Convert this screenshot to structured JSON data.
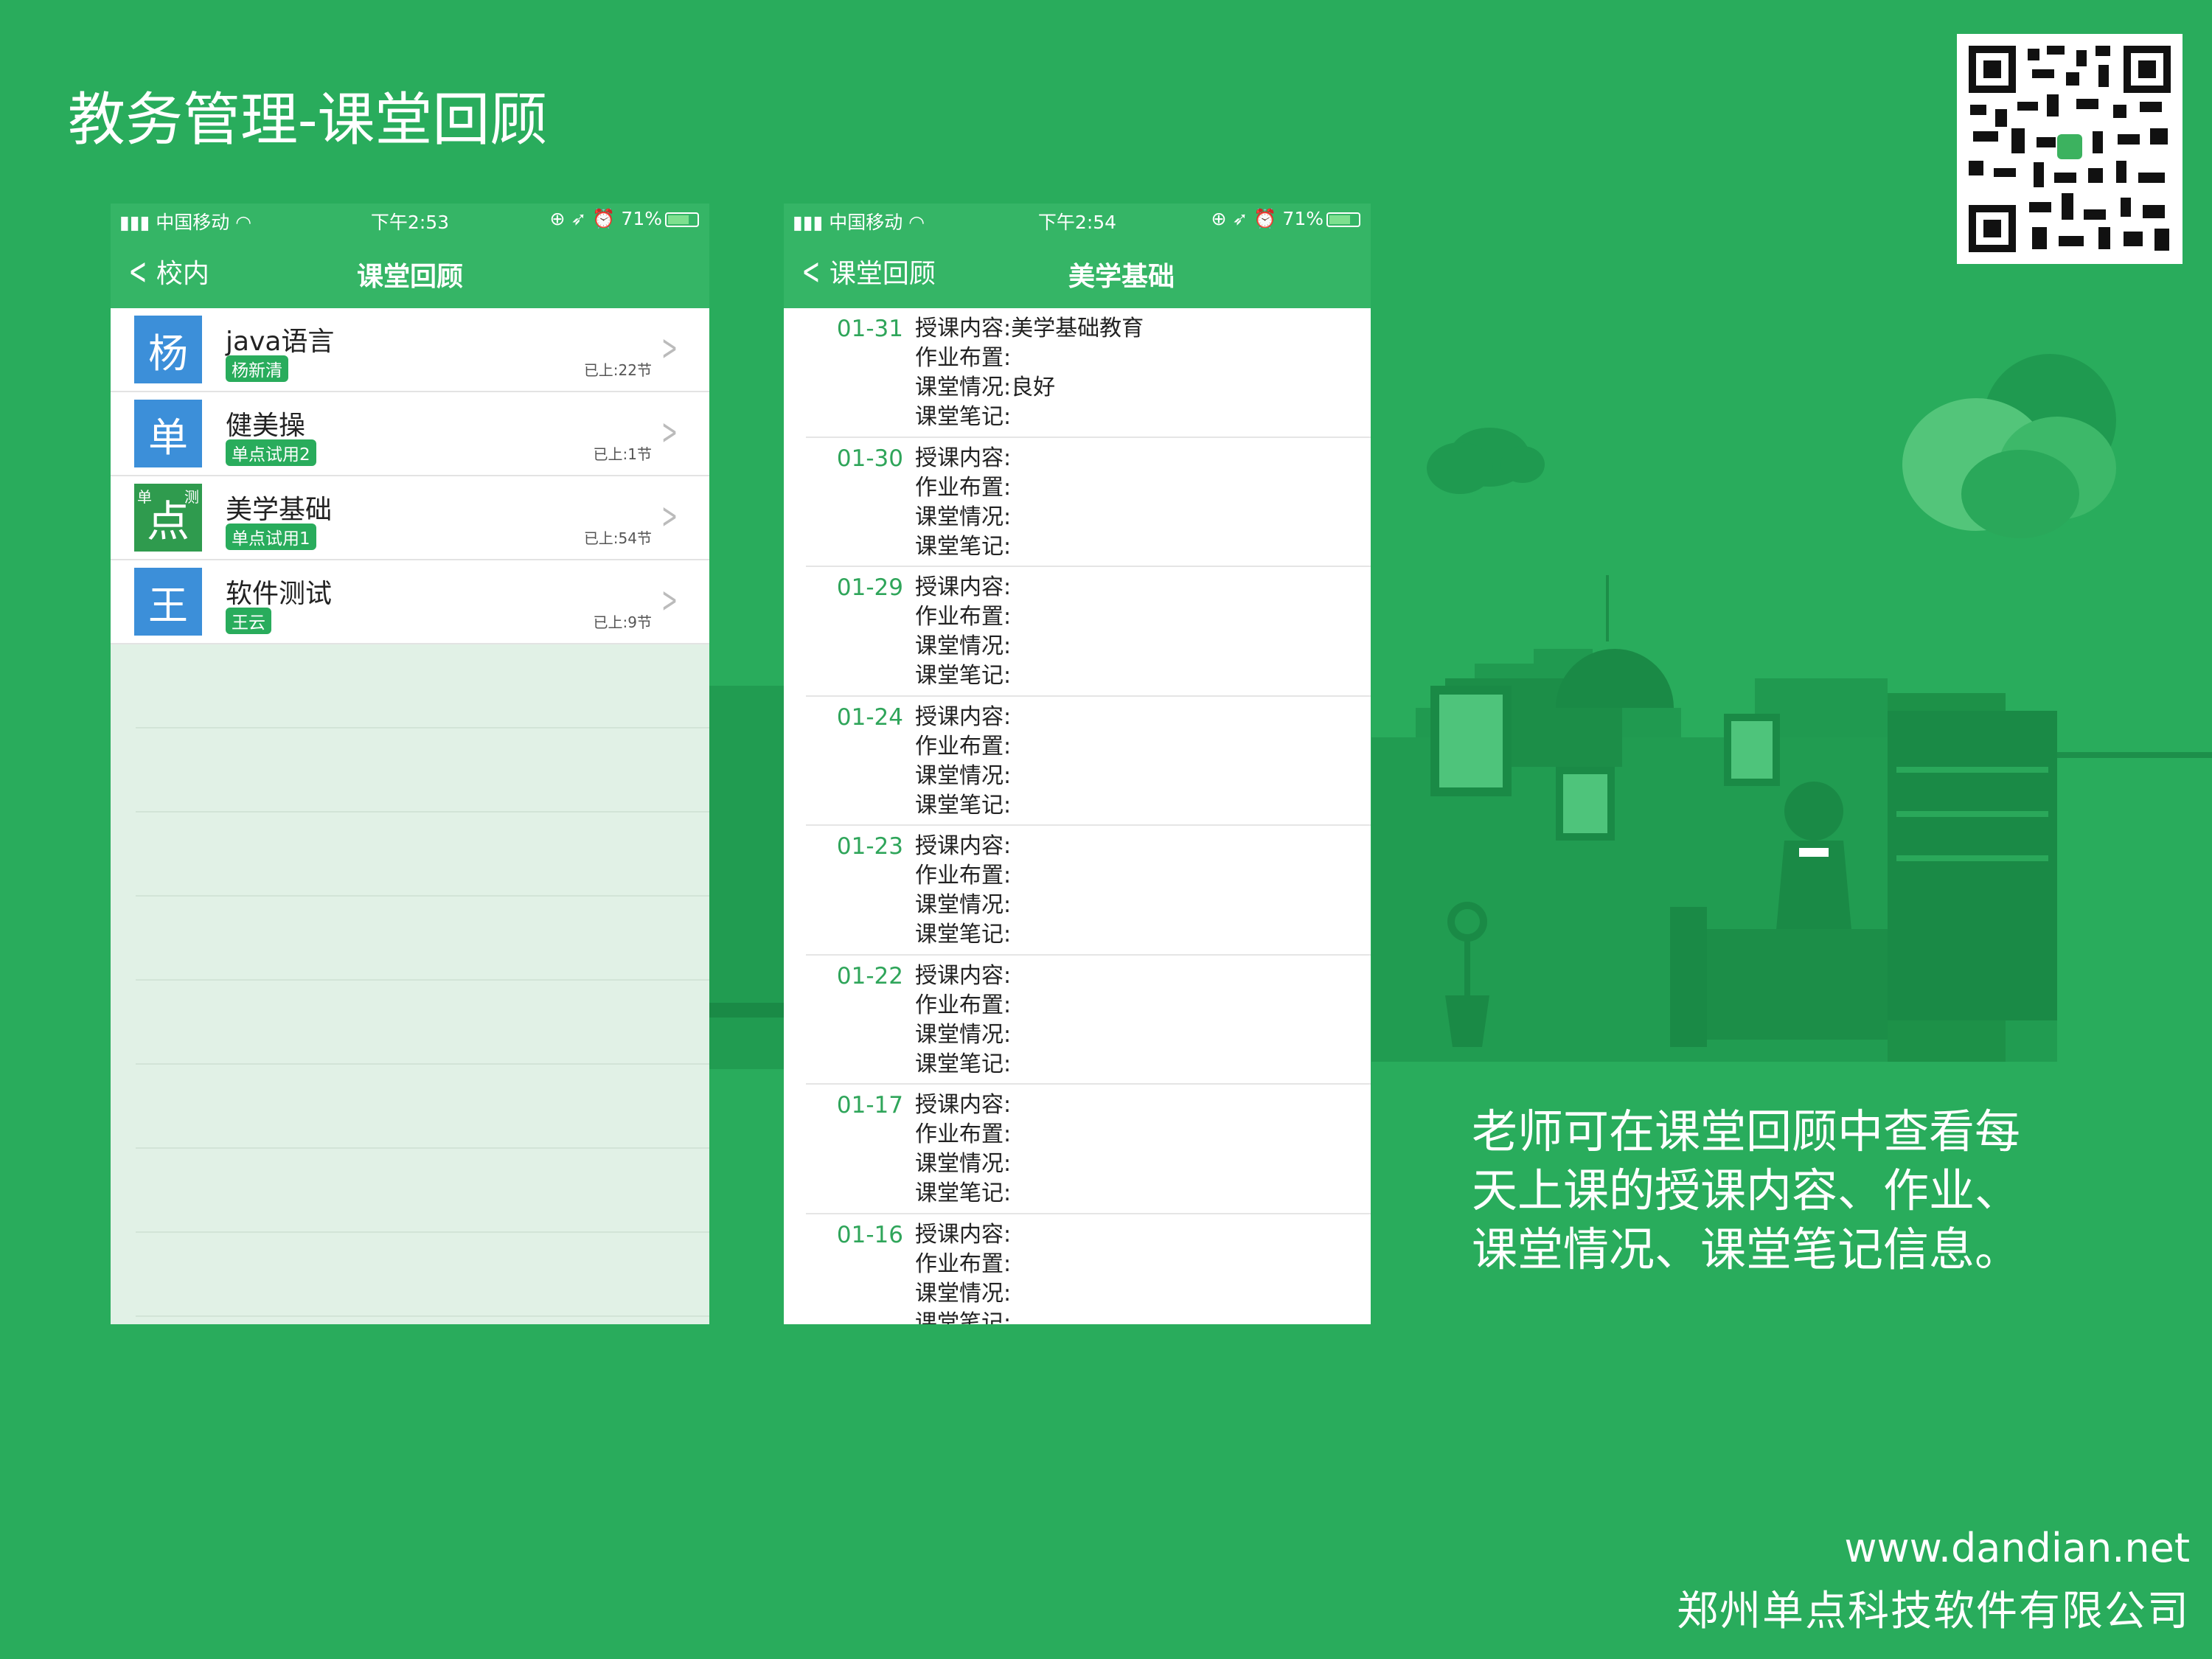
{
  "slide": {
    "title": "教务管理-课堂回顾",
    "description": "老师可在课堂回顾中查看每天上课的授课内容、作业、课堂情况、课堂笔记信息。",
    "website": "www.dandian.net",
    "company": "郑州单点科技软件有限公司"
  },
  "phone1": {
    "status": {
      "carrier": "中国移动",
      "time": "下午2:53",
      "battery": "71%"
    },
    "nav": {
      "back_label": "校内",
      "title": "课堂回顾"
    },
    "courses": [
      {
        "avatar": "杨",
        "name": "java语言",
        "teacher": "杨新清",
        "progress": "已上:22节"
      },
      {
        "avatar": "单",
        "name": "健美操",
        "teacher": "单点试用2",
        "progress": "已上:1节"
      },
      {
        "avatar": "点",
        "avatar_corner_left": "单",
        "avatar_corner_right": "测",
        "name": "美学基础",
        "teacher": "单点试用1",
        "progress": "已上:54节"
      },
      {
        "avatar": "王",
        "name": "软件测试",
        "teacher": "王云",
        "progress": "已上:9节"
      }
    ]
  },
  "phone2": {
    "status": {
      "carrier": "中国移动",
      "time": "下午2:54",
      "battery": "71%"
    },
    "nav": {
      "back_label": "课堂回顾",
      "title": "美学基础"
    },
    "reviews": [
      {
        "date": "01-31",
        "content": "授课内容:美学基础教育",
        "homework": "作业布置:",
        "situation": "课堂情况:良好",
        "notes": "课堂笔记:"
      },
      {
        "date": "01-30",
        "content": "授课内容:",
        "homework": "作业布置:",
        "situation": "课堂情况:",
        "notes": "课堂笔记:"
      },
      {
        "date": "01-29",
        "content": "授课内容:",
        "homework": "作业布置:",
        "situation": "课堂情况:",
        "notes": "课堂笔记:"
      },
      {
        "date": "01-24",
        "content": "授课内容:",
        "homework": "作业布置:",
        "situation": "课堂情况:",
        "notes": "课堂笔记:"
      },
      {
        "date": "01-23",
        "content": "授课内容:",
        "homework": "作业布置:",
        "situation": "课堂情况:",
        "notes": "课堂笔记:"
      },
      {
        "date": "01-22",
        "content": "授课内容:",
        "homework": "作业布置:",
        "situation": "课堂情况:",
        "notes": "课堂笔记:"
      },
      {
        "date": "01-17",
        "content": "授课内容:",
        "homework": "作业布置:",
        "situation": "课堂情况:",
        "notes": "课堂笔记:"
      },
      {
        "date": "01-16",
        "content": "授课内容:",
        "homework": "作业布置:",
        "situation": "课堂情况:",
        "notes": "课堂笔记:"
      }
    ]
  },
  "colors": {
    "background": "#29ac5c",
    "nav": "#35b566",
    "avatar_blue": "#3c8fd9",
    "empty_list": "#e1f1e6"
  },
  "icons": {
    "signal": "signal-icon",
    "wifi": "wifi-icon",
    "back": "chevron-left-icon",
    "row": "chevron-right-icon",
    "qr": "qr-code-icon"
  }
}
